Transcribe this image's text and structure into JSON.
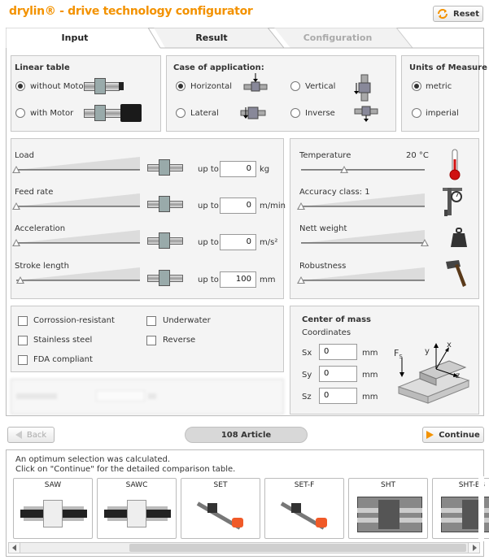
{
  "app": {
    "title": "drylin® - drive technology configurator",
    "reset_label": "Reset"
  },
  "tabs": [
    {
      "label": "Input"
    },
    {
      "label": "Result"
    },
    {
      "label": "Configuration"
    }
  ],
  "linear_table": {
    "title": "Linear table",
    "options": [
      {
        "label": "without Motor",
        "selected": true
      },
      {
        "label": "with Motor",
        "selected": false
      }
    ]
  },
  "case": {
    "title": "Case of application:",
    "options": [
      {
        "label": "Horizontal",
        "selected": true
      },
      {
        "label": "Vertical",
        "selected": false
      },
      {
        "label": "Lateral",
        "selected": false
      },
      {
        "label": "Inverse",
        "selected": false
      }
    ]
  },
  "units": {
    "title": "Units of Measure",
    "options": [
      {
        "label": "metric",
        "selected": true
      },
      {
        "label": "imperial",
        "selected": false
      }
    ]
  },
  "params": [
    {
      "label": "Load",
      "upto": "up to",
      "value": "0",
      "unit": "kg",
      "level": 0
    },
    {
      "label": "Feed rate",
      "upto": "up to",
      "value": "0",
      "unit": "m/min",
      "level": 0
    },
    {
      "label": "Acceleration",
      "upto": "up to",
      "value": "0",
      "unit": "m/s²",
      "level": 0
    },
    {
      "label": "Stroke length",
      "upto": "up to",
      "value": "100",
      "unit": "mm",
      "level": 0.03
    }
  ],
  "env": [
    {
      "label": "Temperature",
      "value": "20 °C",
      "level": 0.35
    },
    {
      "label": "Accuracy class: 1",
      "level": 0
    },
    {
      "label": "Nett weight",
      "level": 1
    },
    {
      "label": "Robustness",
      "level": 0
    }
  ],
  "options": [
    {
      "label": "Corrossion-resistant"
    },
    {
      "label": "Underwater"
    },
    {
      "label": "Stainless steel"
    },
    {
      "label": "Reverse"
    },
    {
      "label": "FDA compliant"
    }
  ],
  "com": {
    "title": "Center of mass",
    "subtitle": "Coordinates",
    "fields": [
      {
        "label": "Sx",
        "value": "0",
        "unit": "mm"
      },
      {
        "label": "Sy",
        "value": "0",
        "unit": "mm"
      },
      {
        "label": "Sz",
        "value": "0",
        "unit": "mm"
      }
    ],
    "fs": "F",
    "fs_sub": "S",
    "ax_x": "x",
    "ax_y": "y",
    "ax_z": "z"
  },
  "nav": {
    "back": "Back",
    "count": "108 Article",
    "continue": "Continue"
  },
  "results": {
    "line1": "An optimum selection was calculated.",
    "line2": "Click on \"Continue\" for the detailed comparison table.",
    "cards": [
      {
        "label": "SAW"
      },
      {
        "label": "SAWC"
      },
      {
        "label": "SET"
      },
      {
        "label": "SET-F"
      },
      {
        "label": "SHT"
      },
      {
        "label": "SHT-BB"
      }
    ]
  },
  "colors": {
    "accent": "#f39200",
    "panel": "#f4f4f4",
    "border": "#c8c8c8"
  }
}
